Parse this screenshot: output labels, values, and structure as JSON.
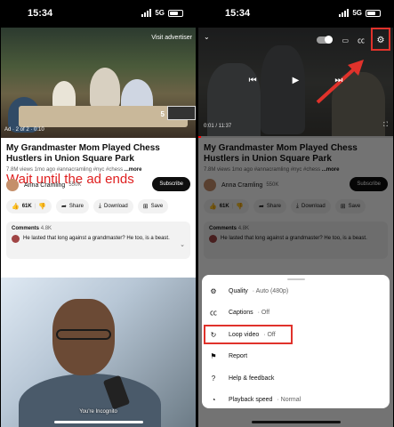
{
  "status": {
    "time": "15:34",
    "network": "5G"
  },
  "video": {
    "title": "My Grandmaster Mom Played Chess Hustlers in Union Square Park",
    "meta_prefix": "7.8M views 1mo ago #annacramling #nyc #chess ",
    "meta_more": "...more",
    "channel": "Anna Cramling",
    "subscribers": "550K",
    "subscribe_label": "Subscribe"
  },
  "ad": {
    "visit_advertiser": "Visit advertiser",
    "ad_label": "Ad · 2 of 2 · 0:10",
    "skip_count": "5"
  },
  "annotation": {
    "wait_text": "Wait until the ad ends"
  },
  "actions": {
    "like_count": "61K",
    "share": "Share",
    "download": "Download",
    "save": "Save"
  },
  "comments": {
    "label": "Comments",
    "count": "4.8K",
    "top_comment": "He lasted that long against a grandmaster? He too, is a beast."
  },
  "promo": {
    "incognito": "You're Incognito"
  },
  "player": {
    "time": "0:01 / 11:37"
  },
  "settings_menu": [
    {
      "label": "Quality",
      "value": " · Auto (480p)",
      "icon": "gear-icon",
      "glyph": "⚙"
    },
    {
      "label": "Captions",
      "value": " · Off",
      "icon": "cc-icon",
      "glyph": "㏄"
    },
    {
      "label": "Loop video",
      "value": " · Off",
      "icon": "loop-icon",
      "glyph": "↻"
    },
    {
      "label": "Report",
      "value": "",
      "icon": "flag-icon",
      "glyph": "⚑"
    },
    {
      "label": "Help & feedback",
      "value": "",
      "icon": "help-icon",
      "glyph": "?"
    },
    {
      "label": "Playback speed",
      "value": " · Normal",
      "icon": "speed-icon",
      "glyph": "◔"
    }
  ],
  "colors": {
    "highlight": "#e0322b",
    "subscribe_bg": "#0f0f0f",
    "progress": "#ff0000"
  }
}
